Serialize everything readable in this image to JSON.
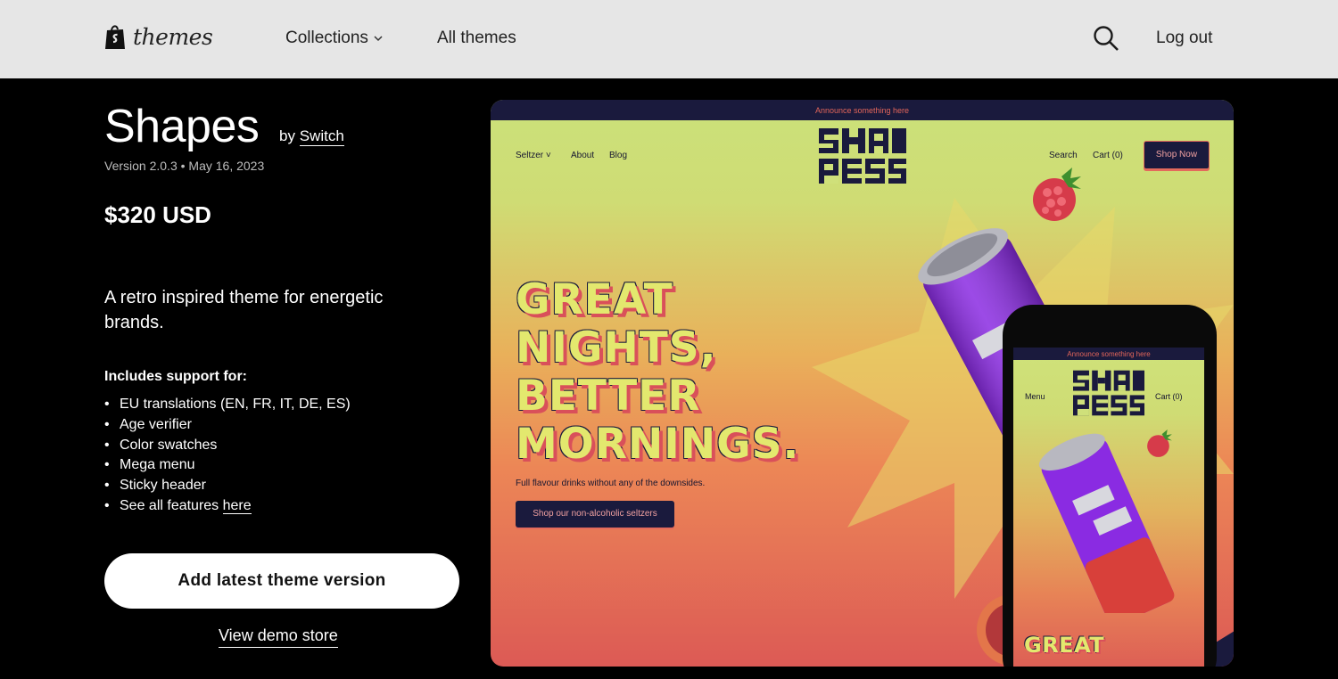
{
  "topnav": {
    "logo_text": "themes",
    "collections_label": "Collections",
    "all_themes_label": "All themes",
    "logout_label": "Log out"
  },
  "theme": {
    "name": "Shapes",
    "by_label": "by",
    "author": "Switch",
    "version": "Version 2.0.3",
    "date": "May 16, 2023",
    "price": "$320 USD",
    "description": "A retro inspired theme for energetic brands.",
    "includes_title": "Includes support for:",
    "features": [
      "EU translations (EN, FR, IT, DE, ES)",
      "Age verifier",
      "Color swatches",
      "Mega menu",
      "Sticky header"
    ],
    "features_more_text": "See all features ",
    "features_more_link": "here",
    "add_button": "Add latest theme version",
    "demo_link": "View demo store"
  },
  "preview": {
    "announcement": "Announce something here",
    "nav": {
      "seltzer": "Seltzer",
      "about": "About",
      "blog": "Blog",
      "search": "Search",
      "cart": "Cart (0)",
      "shop_now": "Shop Now"
    },
    "hero_lines": [
      "GREAT",
      "NIGHTS,",
      "BETTER",
      "MORNINGS."
    ],
    "hero_sub": "Full flavour drinks without any of the downsides.",
    "hero_cta": "Shop our non-alcoholic seltzers",
    "phone": {
      "announcement": "Announce something here",
      "menu": "Menu",
      "cart": "Cart (0)",
      "hero": "GREAT"
    }
  },
  "colors": {
    "nav_bg": "#e6e6e6",
    "page_bg": "#000000",
    "preview_navy": "#1a1a3d",
    "preview_yellow": "#e3e86e",
    "preview_red": "#d9505a",
    "can_purple": "#8a2be2"
  }
}
